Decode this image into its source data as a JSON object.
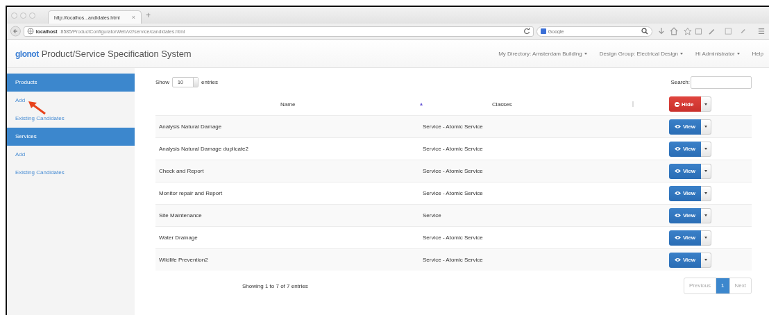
{
  "browser": {
    "tab_title": "http://localhos...andidates.html",
    "tab_close": "×",
    "new_tab": "+",
    "url_host": "localhost",
    "url_path": ":8585/ProductConfiguratorWeb/v2/service/candidates.html",
    "search_placeholder": "Google"
  },
  "navbar": {
    "logo": "glonot",
    "title": "Product/Service Specification System",
    "menus": [
      {
        "label": "My Directory: Amsterdam Building",
        "dropdown": true
      },
      {
        "label": "Design Group: Electrical Design",
        "dropdown": true
      },
      {
        "label": "Hi Administrator",
        "dropdown": true
      },
      {
        "label": "Help",
        "dropdown": false
      }
    ]
  },
  "sidebar": {
    "sections": [
      {
        "title": "Products",
        "items": [
          "Add",
          "Existing Candidates"
        ]
      },
      {
        "title": "Services",
        "items": [
          "Add",
          "Existing Candidates"
        ]
      }
    ]
  },
  "table": {
    "show_label": "Show",
    "page_size": "10",
    "entries_label": "entries",
    "search_label": "Search:",
    "columns": [
      {
        "label": "Name",
        "sorted": true
      },
      {
        "label": "Classes",
        "sorted": false
      }
    ],
    "header_action": {
      "label": "Hide",
      "kind": "hide"
    },
    "rows": [
      {
        "name": "Analysis Natural Damage",
        "classes": "Service - Atomic Service",
        "action": {
          "label": "View",
          "kind": "view"
        }
      },
      {
        "name": "Analysis Natural Damage duplicate2",
        "classes": "Service - Atomic Service",
        "action": {
          "label": "View",
          "kind": "view"
        }
      },
      {
        "name": "Check and Report",
        "classes": "Service - Atomic Service",
        "action": {
          "label": "View",
          "kind": "view"
        }
      },
      {
        "name": "Monitor repair and Report",
        "classes": "Service - Atomic Service",
        "action": {
          "label": "View",
          "kind": "view"
        }
      },
      {
        "name": "Site Maintenance",
        "classes": "Service",
        "action": {
          "label": "View",
          "kind": "view"
        }
      },
      {
        "name": "Water Drainage",
        "classes": "Service - Atomic Service",
        "action": {
          "label": "View",
          "kind": "view"
        }
      },
      {
        "name": "Wildlife Prevention2",
        "classes": "Service - Atomic Service",
        "action": {
          "label": "View",
          "kind": "view"
        }
      }
    ],
    "info": "Showing 1 to 7 of 7 entries",
    "pagination": [
      {
        "label": "Previous",
        "selected": false,
        "disabled": true
      },
      {
        "label": "1",
        "selected": true,
        "disabled": false
      },
      {
        "label": "Next",
        "selected": false,
        "disabled": true
      }
    ]
  }
}
